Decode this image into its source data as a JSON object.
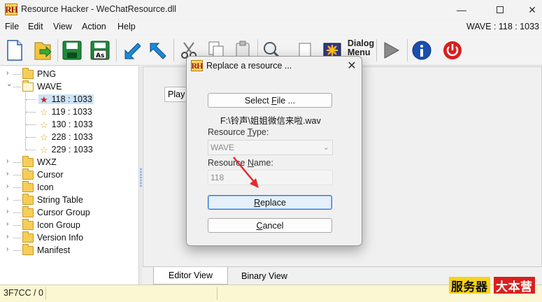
{
  "window": {
    "logo_text": "RH",
    "title": "Resource Hacker - WeChatResource.dll",
    "min": "—",
    "close": "✕"
  },
  "menu": {
    "file": "File",
    "edit": "Edit",
    "view": "View",
    "action": "Action",
    "help": "Help",
    "resource_indicator": "WAVE : 118 : 1033"
  },
  "toolbar": {
    "dialog_menu_label": "Dialog\nMenu"
  },
  "tree": {
    "items": [
      {
        "label": "PNG",
        "expander": "›"
      },
      {
        "label": "WAVE",
        "expander": "⌄"
      },
      {
        "label": "118 : 1033"
      },
      {
        "label": "119 : 1033"
      },
      {
        "label": "130 : 1033"
      },
      {
        "label": "228 : 1033"
      },
      {
        "label": "229 : 1033"
      },
      {
        "label": "WXZ",
        "expander": "›"
      },
      {
        "label": "Cursor",
        "expander": "›"
      },
      {
        "label": "Icon",
        "expander": "›"
      },
      {
        "label": "String Table",
        "expander": "›"
      },
      {
        "label": "Cursor Group",
        "expander": "›"
      },
      {
        "label": "Icon Group",
        "expander": "›"
      },
      {
        "label": "Version Info",
        "expander": "›"
      },
      {
        "label": "Manifest",
        "expander": "›"
      }
    ]
  },
  "editor": {
    "play_label": "Play WAV"
  },
  "tabs": {
    "editor_view": "Editor View",
    "binary_view": "Binary View"
  },
  "statusbar": {
    "text": "3F7CC / 0"
  },
  "watermark": {
    "left": "服务器",
    "right": "大本营"
  },
  "dialog": {
    "logo_text": "RH",
    "title": "Replace a resource ...",
    "close": "✕",
    "select_file_prefix": "Select ",
    "select_file_underline": "F",
    "select_file_suffix": "ile ...",
    "file_path": "F:\\铃声\\姐姐微信来啦.wav",
    "type_label_prefix": "Resource ",
    "type_label_underline": "T",
    "type_label_suffix": "ype:",
    "type_value": "WAVE",
    "name_label_prefix": "Resource ",
    "name_label_underline": "N",
    "name_label_suffix": "ame:",
    "name_value": "118",
    "replace_underline": "R",
    "replace_suffix": "eplace",
    "cancel_underline": "C",
    "cancel_suffix": "ancel"
  }
}
